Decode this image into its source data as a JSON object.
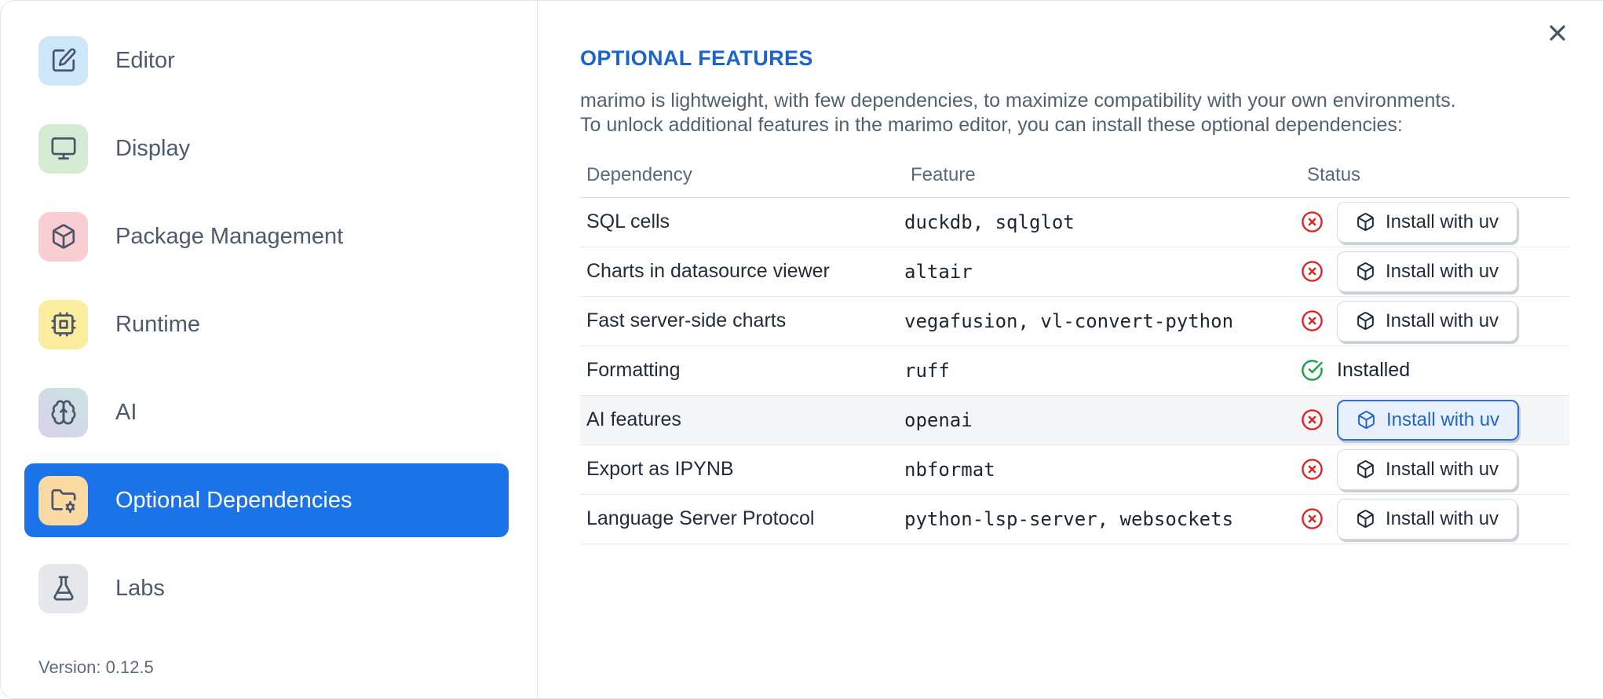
{
  "sidebar": {
    "items": [
      {
        "label": "Editor",
        "icon": "square-pen-icon",
        "icon_bg": "#cde7fa",
        "selected": false
      },
      {
        "label": "Display",
        "icon": "monitor-icon",
        "icon_bg": "#d5ecd4",
        "selected": false
      },
      {
        "label": "Package Management",
        "icon": "package-icon",
        "icon_bg": "#f9ced2",
        "selected": false
      },
      {
        "label": "Runtime",
        "icon": "cpu-icon",
        "icon_bg": "#fbec9e",
        "selected": false
      },
      {
        "label": "AI",
        "icon": "brain-icon",
        "icon_bg": "gradient",
        "icon_bg_gradient": [
          "#ddcdec",
          "#c6e7e0"
        ],
        "selected": false
      },
      {
        "label": "Optional Dependencies",
        "icon": "folder-cog-icon",
        "icon_bg": "#fbd9a3",
        "selected": true
      },
      {
        "label": "Labs",
        "icon": "flask-icon",
        "icon_bg": "#e5e7ea",
        "selected": false
      }
    ],
    "version": "Version: 0.12.5",
    "selected_bg": "#1a73e8"
  },
  "main": {
    "title": "OPTIONAL FEATURES",
    "description_lines": [
      "marimo is lightweight, with few dependencies, to maximize compatibility with your own environments.",
      "To unlock additional features in the marimo editor, you can install these optional dependencies:"
    ],
    "table": {
      "headers": [
        "Dependency",
        "Feature",
        "Status"
      ],
      "rows": [
        {
          "dependency": "SQL cells",
          "feature": "duckdb, sqlglot",
          "installed": false,
          "action_label": "Install with uv",
          "highlighted": false
        },
        {
          "dependency": "Charts in datasource viewer",
          "feature": "altair",
          "installed": false,
          "action_label": "Install with uv",
          "highlighted": false
        },
        {
          "dependency": "Fast server-side charts",
          "feature": "vegafusion, vl-convert-python",
          "installed": false,
          "action_label": "Install with uv",
          "highlighted": false
        },
        {
          "dependency": "Formatting",
          "feature": "ruff",
          "installed": true,
          "status_text": "Installed",
          "highlighted": false
        },
        {
          "dependency": "AI features",
          "feature": "openai",
          "installed": false,
          "action_label": "Install with uv",
          "highlighted": true
        },
        {
          "dependency": "Export as IPYNB",
          "feature": "nbformat",
          "installed": false,
          "action_label": "Install with uv",
          "highlighted": false
        },
        {
          "dependency": "Language Server Protocol",
          "feature": "python-lsp-server, websockets",
          "installed": false,
          "action_label": "Install with uv",
          "highlighted": false
        }
      ]
    }
  },
  "colors": {
    "accent_blue": "#1a73e8",
    "title_blue": "#1a63d0",
    "error_red": "#dc2626",
    "success_green": "#16a34a",
    "focus_button_border": "#2e6fd8"
  }
}
